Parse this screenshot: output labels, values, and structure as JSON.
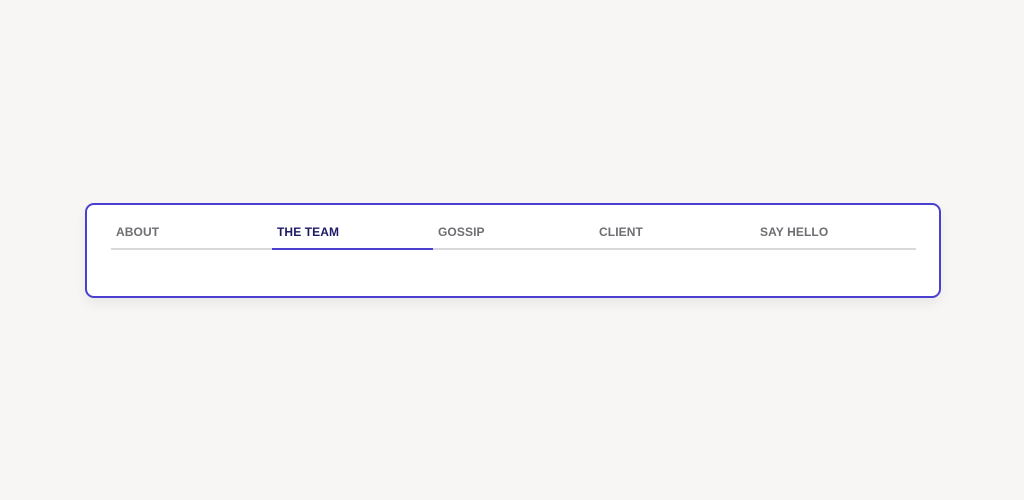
{
  "tabs": [
    {
      "label": "ABOUT",
      "active": false
    },
    {
      "label": "THE TEAM",
      "active": true
    },
    {
      "label": "GOSSIP",
      "active": false
    },
    {
      "label": "CLIENT",
      "active": false
    },
    {
      "label": "SAY HELLO",
      "active": false
    }
  ],
  "colors": {
    "accent": "#4b3fd0",
    "active_text": "#1e1a66",
    "inactive_text": "#6e6e73",
    "page_background": "#f7f6f4",
    "card_background": "#ffffff",
    "track": "#d9d9dc"
  }
}
